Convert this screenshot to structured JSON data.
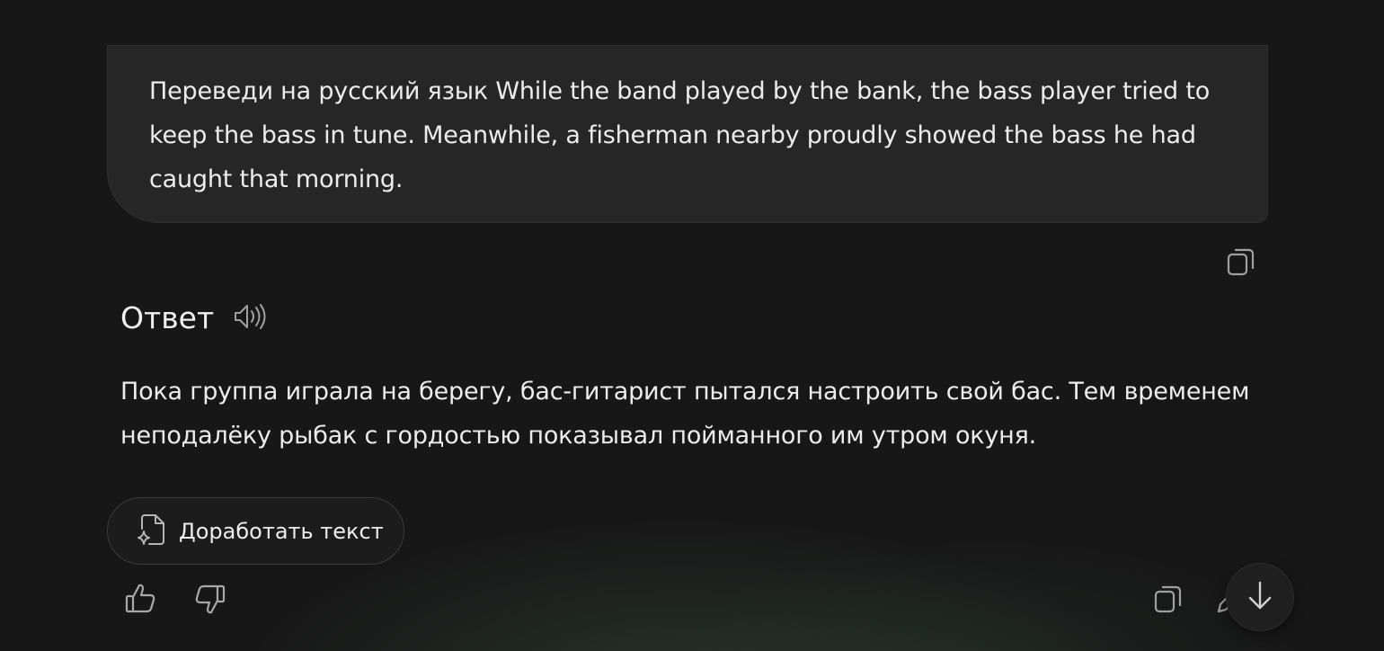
{
  "user_message": {
    "text": "Переведи на русский язык While the band played by the bank, the bass player tried to keep the bass in tune. Meanwhile, a fisherman nearby proudly showed the bass he had caught that morning."
  },
  "answer": {
    "title": "Ответ",
    "text": "Пока группа играла на берегу, бас-гитарист пытался настроить свой бас. Тем временем неподалёку рыбак с гордостью показывал пойманного им утром окуня."
  },
  "actions": {
    "refine_label": "Доработать текст"
  },
  "icons": {
    "copy": "copy-icon",
    "speaker": "speaker-icon",
    "refine": "document-sparkle-icon",
    "like": "thumbs-up-icon",
    "dislike": "thumbs-down-icon",
    "edit": "pencil-icon",
    "scroll": "arrow-down-icon"
  },
  "colors": {
    "background": "#171717",
    "bubble": "#262626",
    "text": "#ececec",
    "icon": "#9a9a9a"
  }
}
